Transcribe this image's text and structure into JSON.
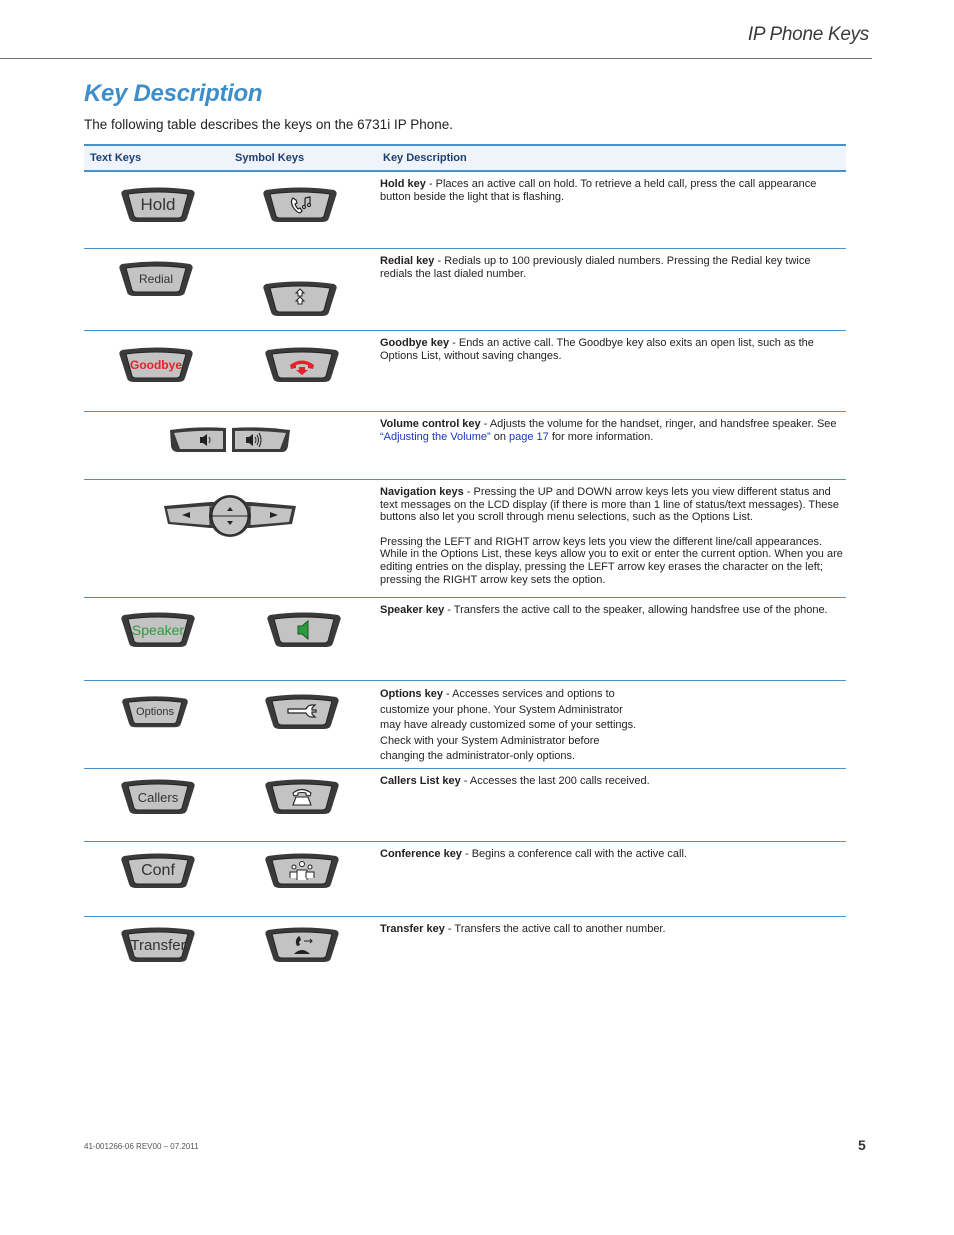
{
  "header": {
    "section_title": "IP Phone Keys"
  },
  "page_title": "Key Description",
  "intro": "The following table describes the keys on the 6731i IP Phone.",
  "table": {
    "columns": [
      "Text Keys",
      "Symbol Keys",
      "Key Description"
    ],
    "rows": [
      {
        "text_key": "Hold",
        "symbol_icon": "hold-music-handset-icon",
        "title": "Hold key",
        "desc": " - Places an active call on hold. To retrieve a held call, press the call appearance button beside the light that is flashing."
      },
      {
        "text_key": "Redial",
        "symbol_icon": "double-up-arrow-icon",
        "title": "Redial key",
        "desc": " - Redials up to 100 previously dialed numbers. Pressing the Redial key twice redials the last dialed number."
      },
      {
        "text_key": "Goodbye",
        "text_color": "#e8202a",
        "symbol_icon": "hang-up-handset-icon",
        "title": "Goodbye key",
        "desc": " - Ends an active call. The Goodbye key also exits an open list, such as the Options List, without saving changes."
      },
      {
        "text_key": "",
        "symbol_icon": "volume-down-up-icon",
        "title": "Volume control key",
        "desc": " - Adjusts the volume for the handset, ringer, and handsfree speaker. See ",
        "link1": "“Adjusting the Volume”",
        "mid": " on ",
        "link2": "page 17",
        "tail": " for more information."
      },
      {
        "text_key": "",
        "symbol_icon": "navigation-arrows-icon",
        "title": "Navigation keys",
        "desc": " - Pressing the UP and DOWN arrow keys lets you view different status and text messages on the LCD display (if there is more than 1 line of status/text messages). These buttons also let you scroll through menu selections, such as the Options List.",
        "desc2": "Pressing the LEFT and RIGHT arrow keys lets you view the different line/call appearances. While in the Options List, these keys allow you to exit or enter the current option. When you are editing entries on the display, pressing the LEFT arrow key erases the character on the left; pressing the RIGHT arrow key sets the option."
      },
      {
        "text_key": "Speaker",
        "text_color": "#2e9a3e",
        "symbol_icon": "speaker-icon",
        "title": "Speaker key",
        "desc": " - Transfers the active call to the speaker, allowing handsfree use of the phone."
      },
      {
        "text_key": "Options",
        "symbol_icon": "wrench-icon",
        "title": "Options key",
        "desc": " - Accesses services and options to customize your phone. Your System Administrator may have already customized some of your settings. Check with your System Administrator before changing the administrator-only options."
      },
      {
        "text_key": "Callers",
        "symbol_icon": "desk-phone-icon",
        "title": "Callers List key",
        "desc": " - Accesses the last 200 calls received."
      },
      {
        "text_key": "Conf",
        "symbol_icon": "conference-people-icon",
        "title": "Conference key",
        "desc": " - Begins a conference call with the active call."
      },
      {
        "text_key": "Transfer",
        "symbol_icon": "transfer-handset-icon",
        "title": "Transfer key",
        "desc": " - Transfers the active call to another number."
      }
    ]
  },
  "footer": {
    "doc_number": "41-001266-06 REV00 – 07.2011",
    "page_number": "5"
  },
  "colors": {
    "accent": "#3d8ec9",
    "rule": "#4a90c8",
    "header_bg": "#eef4fa",
    "goodbye": "#e8202a",
    "speaker": "#2e9a3e",
    "link": "#1a35c8"
  }
}
